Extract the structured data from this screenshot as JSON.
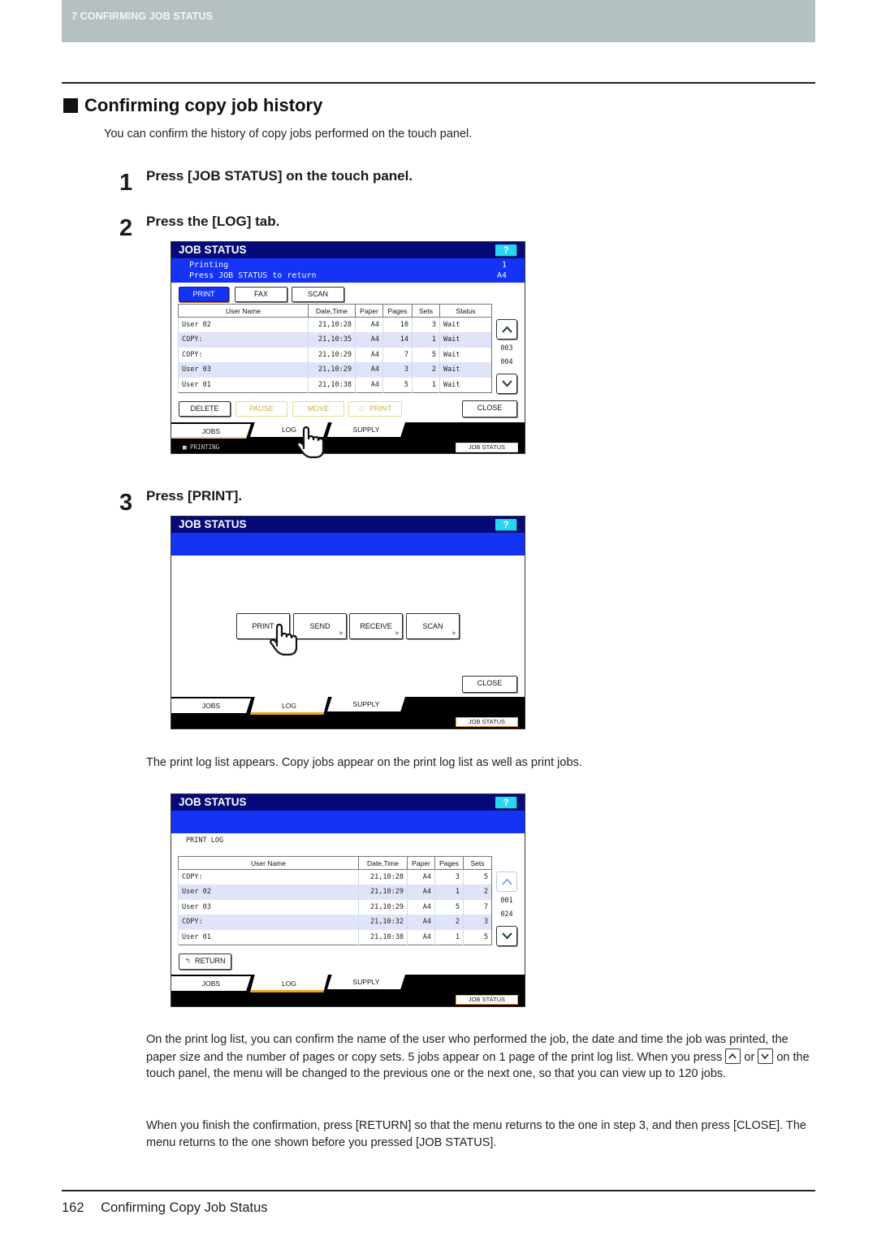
{
  "header": {
    "chapter": "7 CONFIRMING JOB STATUS"
  },
  "section": {
    "title": "Confirming copy job history",
    "intro": "You can confirm the history of copy jobs performed on the touch panel."
  },
  "steps": [
    {
      "num": "1",
      "text": "Press [JOB STATUS] on the touch panel."
    },
    {
      "num": "2",
      "text": "Press the [LOG] tab."
    },
    {
      "num": "3",
      "text": "Press [PRINT]."
    }
  ],
  "panel1": {
    "title": "JOB STATUS",
    "help": "?",
    "msg_line1": "Printing",
    "msg_line2": "Press JOB STATUS to return",
    "msg_right1": "1",
    "msg_right2": "A4",
    "type_tabs": [
      "PRINT",
      "FAX",
      "SCAN"
    ],
    "columns": [
      "User Name",
      "Date,Time",
      "Paper",
      "Pages",
      "Sets",
      "Status"
    ],
    "rows": [
      {
        "user": "User 02",
        "datetime": "21,10:28",
        "paper": "A4",
        "pages": "10",
        "sets": "3",
        "status": "Wait"
      },
      {
        "user": "COPY:",
        "datetime": "21,10:35",
        "paper": "A4",
        "pages": "14",
        "sets": "1",
        "status": "Wait"
      },
      {
        "user": "COPY:",
        "datetime": "21,10:29",
        "paper": "A4",
        "pages": "7",
        "sets": "5",
        "status": "Wait"
      },
      {
        "user": "User 03",
        "datetime": "21,10:29",
        "paper": "A4",
        "pages": "3",
        "sets": "2",
        "status": "Wait"
      },
      {
        "user": "User 01",
        "datetime": "21,10:38",
        "paper": "A4",
        "pages": "5",
        "sets": "1",
        "status": "Wait"
      }
    ],
    "page_current": "003",
    "page_total": "004",
    "actions": [
      "DELETE",
      "PAUSE",
      "MOVE",
      "PRINT",
      "CLOSE"
    ],
    "tabs": [
      "JOBS",
      "LOG",
      "SUPPLY"
    ],
    "status_text": "PRINTING",
    "job_status_button": "JOB STATUS"
  },
  "panel2": {
    "title": "JOB STATUS",
    "help": "?",
    "log_buttons": [
      "PRINT",
      "SEND",
      "RECEIVE",
      "SCAN"
    ],
    "close": "CLOSE",
    "tabs": [
      "JOBS",
      "LOG",
      "SUPPLY"
    ],
    "job_status_button": "JOB STATUS"
  },
  "after_step3": "The print log list appears. Copy jobs appear on the print log list as well as print jobs.",
  "panel3": {
    "title": "JOB STATUS",
    "help": "?",
    "log_title": "PRINT LOG",
    "columns": [
      "User Name",
      "Date,Time",
      "Paper",
      "Pages",
      "Sets"
    ],
    "rows": [
      {
        "user": "COPY:",
        "datetime": "21,10:28",
        "paper": "A4",
        "pages": "3",
        "sets": "5"
      },
      {
        "user": "User 02",
        "datetime": "21,10:29",
        "paper": "A4",
        "pages": "1",
        "sets": "2"
      },
      {
        "user": "User 03",
        "datetime": "21,10:29",
        "paper": "A4",
        "pages": "5",
        "sets": "7"
      },
      {
        "user": "COPY:",
        "datetime": "21,10:32",
        "paper": "A4",
        "pages": "2",
        "sets": "3"
      },
      {
        "user": "User 01",
        "datetime": "21,10:38",
        "paper": "A4",
        "pages": "1",
        "sets": "5"
      }
    ],
    "page_current": "001",
    "page_total": "024",
    "return": "RETURN",
    "tabs": [
      "JOBS",
      "LOG",
      "SUPPLY"
    ],
    "job_status_button": "JOB STATUS"
  },
  "body": {
    "p1_a": "On the print log list, you can confirm the name of the user who performed the job, the date and time the job was printed, the paper size and the number of pages or copy sets. 5 jobs appear on 1 page of the print log list. When you press",
    "p1_or": "or",
    "p1_b": "on the touch panel, the menu will be changed to the previous one or the next one, so that you can view up to 120 jobs.",
    "p2": "When you finish the confirmation, press [RETURN] so that the menu returns to the one in step 3, and then press [CLOSE]. The menu returns to the one shown before you pressed [JOB STATUS]."
  },
  "footer": {
    "page": "162",
    "title": "Confirming Copy Job Status"
  }
}
